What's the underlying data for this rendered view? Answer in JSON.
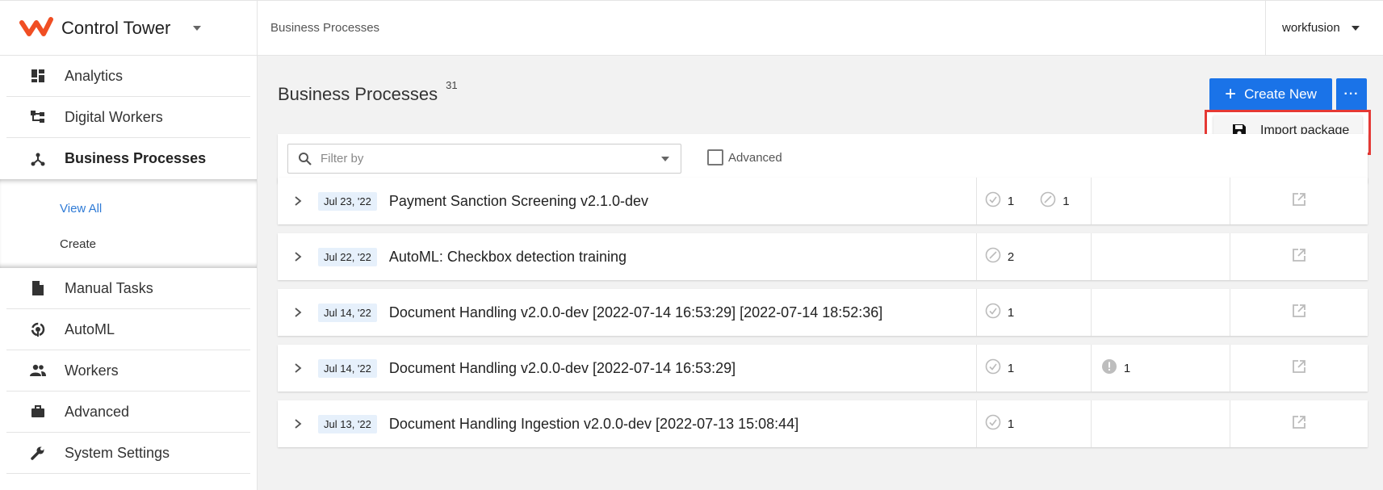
{
  "app": {
    "title": "Control Tower",
    "user": "workfusion",
    "accent": "#1a73e8",
    "brand_color": "#f04e23"
  },
  "breadcrumb": "Business Processes",
  "sidebar": {
    "items": [
      {
        "label": "Analytics",
        "icon": "analytics-icon"
      },
      {
        "label": "Digital Workers",
        "icon": "digital-workers-icon"
      },
      {
        "label": "Business Processes",
        "icon": "business-processes-icon"
      },
      {
        "label": "Manual Tasks",
        "icon": "document-icon"
      },
      {
        "label": "AutoML",
        "icon": "automl-icon"
      },
      {
        "label": "Workers",
        "icon": "people-icon"
      },
      {
        "label": "Advanced",
        "icon": "briefcase-icon"
      },
      {
        "label": "System Settings",
        "icon": "wrench-icon"
      }
    ],
    "sub_items": [
      {
        "label": "View All"
      },
      {
        "label": "Create"
      }
    ]
  },
  "main": {
    "title": "Business Processes",
    "count": "31",
    "create_label": "Create New",
    "more_label": "···",
    "menu_item": "Import package",
    "filter_placeholder": "Filter by",
    "advanced_label": "Advanced"
  },
  "rows": [
    {
      "date": "Jul 23, '22",
      "name": "Payment Sanction Screening v2.1.0-dev",
      "stats": [
        "1",
        "1"
      ],
      "alert": ""
    },
    {
      "date": "Jul 22, '22",
      "name": "AutoML: Checkbox detection training",
      "stats": [
        "2"
      ],
      "alert": ""
    },
    {
      "date": "Jul 14, '22",
      "name": "Document Handling v2.0.0-dev [2022-07-14 16:53:29] [2022-07-14 18:52:36]",
      "stats": [
        "1"
      ],
      "alert": ""
    },
    {
      "date": "Jul 14, '22",
      "name": "Document Handling v2.0.0-dev [2022-07-14 16:53:29]",
      "stats": [
        "1"
      ],
      "alert": "1"
    },
    {
      "date": "Jul 13, '22",
      "name": "Document Handling Ingestion v2.0.0-dev [2022-07-13 15:08:44]",
      "stats": [
        "1"
      ],
      "alert": ""
    }
  ]
}
